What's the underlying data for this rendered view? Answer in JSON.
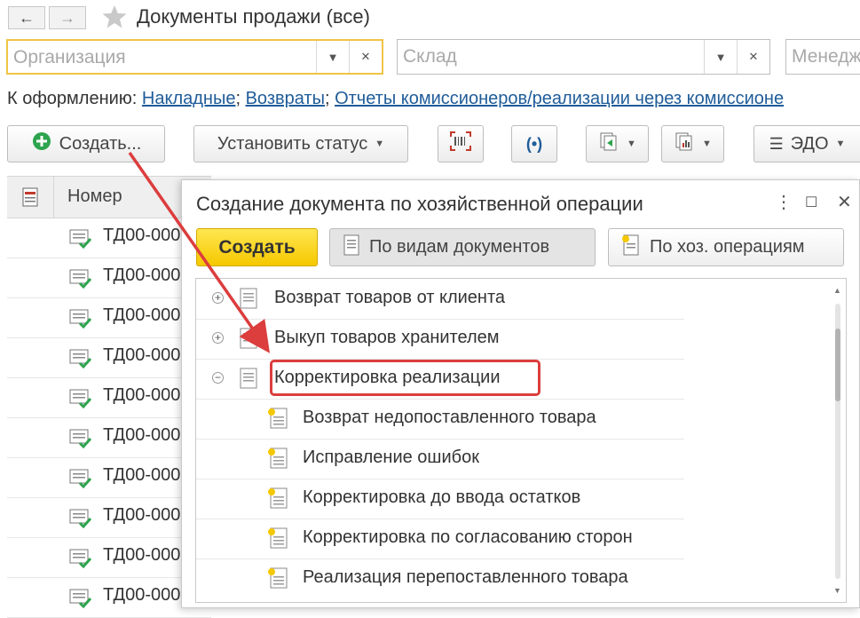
{
  "window": {
    "title": "Документы продажи (все)",
    "back_label": "←",
    "forward_label": "→"
  },
  "filters": {
    "organization": {
      "placeholder": "Организация"
    },
    "warehouse": {
      "placeholder": "Склад"
    },
    "manager": {
      "placeholder": "Менедж"
    }
  },
  "links": {
    "prefix": "К оформлению: ",
    "items": [
      "Накладные",
      "Возвраты",
      "Отчеты комиссионеров/реализации через комиссионе"
    ],
    "separator": "; "
  },
  "toolbar": {
    "create_label": "Создать...",
    "set_status_label": "Установить статус",
    "edo_label": "ЭДО"
  },
  "table": {
    "header_number": "Номер",
    "rows": [
      "ТД00-000",
      "ТД00-000",
      "ТД00-000",
      "ТД00-000",
      "ТД00-000",
      "ТД00-000",
      "ТД00-000",
      "ТД00-000",
      "ТД00-000",
      "ТД00-000"
    ]
  },
  "dialog": {
    "title": "Создание документа по хозяйственной операции",
    "create_label": "Создать",
    "by_doc_types_label": "По видам документов",
    "by_operations_label": "По хоз. операциям",
    "groups": [
      {
        "label": "Возврат товаров от клиента",
        "expander": "+"
      },
      {
        "label": "Выкуп товаров хранителем",
        "expander": "+"
      },
      {
        "label": "Корректировка реализации",
        "expander": "−"
      }
    ],
    "children": [
      "Возврат недопоставленного товара",
      "Исправление ошибок",
      "Корректировка до ввода остатков",
      "Корректировка по согласованию сторон",
      "Реализация перепоставленного товара"
    ]
  },
  "colors": {
    "link": "#1f5c99",
    "create_button": "#f5c800",
    "highlight": "#dc3d3d",
    "arrow": "#dc3d3d",
    "check": "#2da44e"
  }
}
